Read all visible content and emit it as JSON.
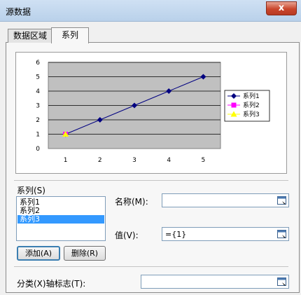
{
  "window": {
    "title": "源数据",
    "close_glyph": "x"
  },
  "tabs": [
    {
      "label": "数据区域"
    },
    {
      "label": "系列"
    }
  ],
  "chart_data": {
    "type": "line",
    "categories": [
      "1",
      "2",
      "3",
      "4",
      "5"
    ],
    "series": [
      {
        "name": "系列1",
        "values": [
          1,
          2,
          3,
          4,
          5
        ],
        "color": "#000080",
        "marker": "diamond"
      },
      {
        "name": "系列2",
        "values": [
          1
        ],
        "color": "#ff00ff",
        "marker": "square"
      },
      {
        "name": "系列3",
        "values": [
          1
        ],
        "color": "#ffff00",
        "marker": "triangle"
      }
    ],
    "yticks": [
      "0",
      "1",
      "2",
      "3",
      "4",
      "5",
      "6"
    ],
    "ylim": [
      0,
      6
    ],
    "plot_background": "#c0c0c0",
    "grid": true,
    "legend_position": "right"
  },
  "series_section": {
    "label": "系列(S)",
    "items": [
      "系列1",
      "系列2",
      "系列3"
    ],
    "selected_index": 2,
    "name_label": "名称(M):",
    "name_value": "",
    "value_label": "值(V):",
    "value_value": "={1}"
  },
  "buttons": {
    "add": "添加(A)",
    "delete": "删除(R)"
  },
  "category": {
    "label": "分类(X)轴标志(T):",
    "value": ""
  }
}
